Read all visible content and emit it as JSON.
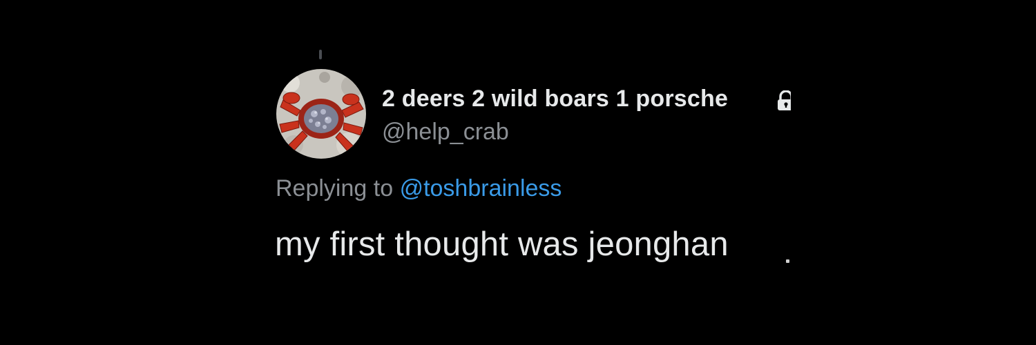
{
  "author": {
    "display_name": "2 deers 2 wild boars 1 porsche",
    "handle": "@help_crab",
    "protected_icon": "lock-icon",
    "avatar_icon": "crab-avatar"
  },
  "reply": {
    "prefix": "Replying to",
    "mention": "@toshbrainless"
  },
  "tweet": {
    "text": "my first thought was jeonghan"
  },
  "colors": {
    "background": "#000000",
    "primary_text": "#e7e9ea",
    "secondary_text": "#8b8f94",
    "link": "#3a9be8"
  }
}
